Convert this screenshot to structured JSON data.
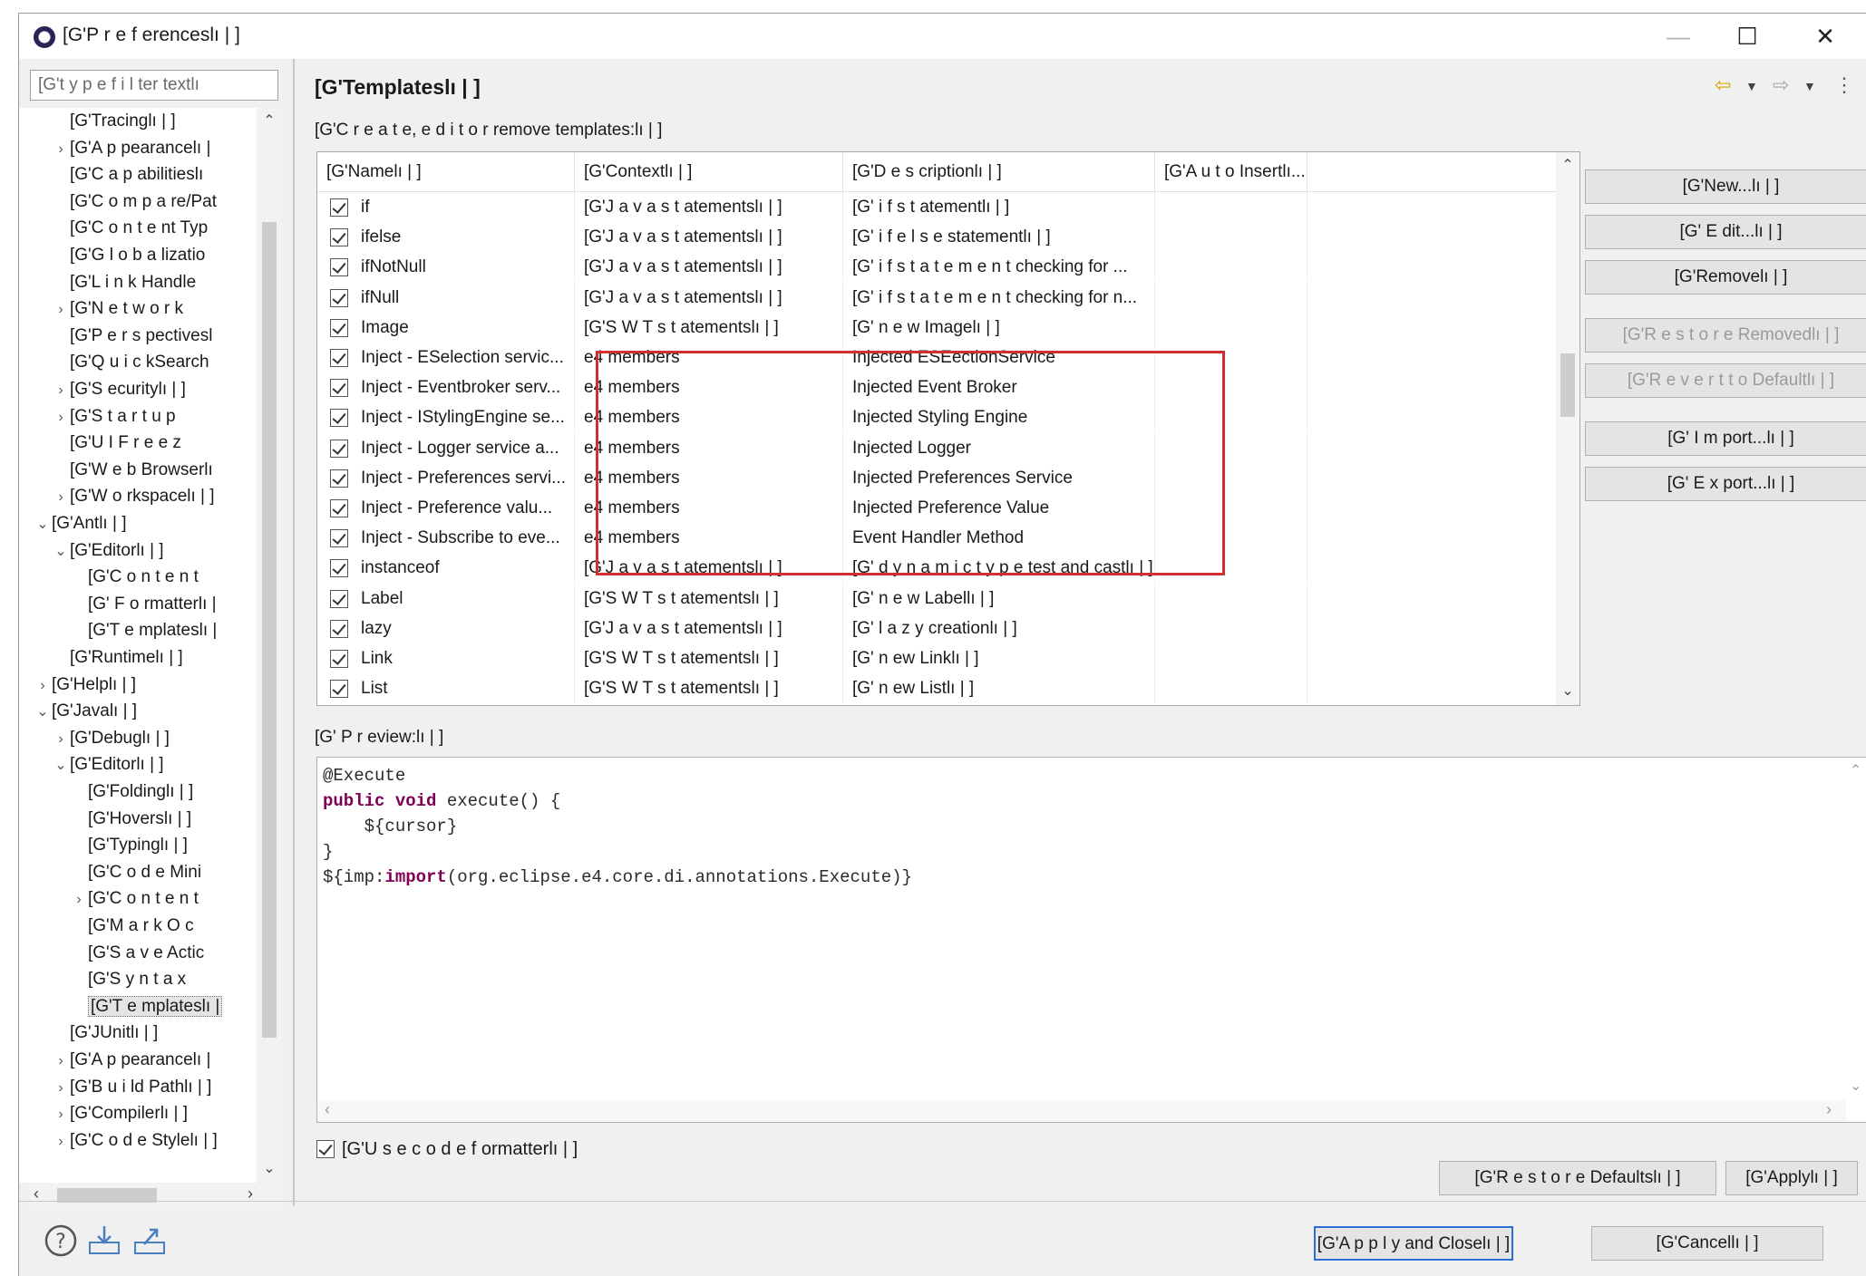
{
  "window": {
    "title": "[G'P r e f erenceslı | ]"
  },
  "filter": {
    "placeholder": "[G't y p e  f i l ter textlı"
  },
  "tree": {
    "items": [
      {
        "label": "[G'Tracinglı | ]",
        "indent": 2,
        "arrow": ""
      },
      {
        "label": "[G'A p pearancelı |",
        "indent": 2,
        "arrow": "›"
      },
      {
        "label": "[G'C a p abilitieslı",
        "indent": 2,
        "arrow": ""
      },
      {
        "label": "[G'C o m p a re/Pat",
        "indent": 2,
        "arrow": ""
      },
      {
        "label": "[G'C o n t e nt Typ",
        "indent": 2,
        "arrow": ""
      },
      {
        "label": "[G'G l o b a lizatio",
        "indent": 2,
        "arrow": ""
      },
      {
        "label": "[G'L i n k  Handle",
        "indent": 2,
        "arrow": ""
      },
      {
        "label": "[G'N e t w o r k",
        "indent": 2,
        "arrow": "›"
      },
      {
        "label": "[G'P e r s pectivesl",
        "indent": 2,
        "arrow": ""
      },
      {
        "label": "[G'Q u i c kSearch",
        "indent": 2,
        "arrow": ""
      },
      {
        "label": "[G'S ecuritylı | ]",
        "indent": 2,
        "arrow": "›"
      },
      {
        "label": "[G'S t a r t u p",
        "indent": 2,
        "arrow": "›"
      },
      {
        "label": "[G'U I  F r e e z",
        "indent": 2,
        "arrow": ""
      },
      {
        "label": "[G'W e b  Browserlı",
        "indent": 2,
        "arrow": ""
      },
      {
        "label": "[G'W o rkspacelı | ]",
        "indent": 2,
        "arrow": "›"
      },
      {
        "label": "[G'Antlı | ]",
        "indent": 1,
        "arrow": "⌄"
      },
      {
        "label": "[G'Editorlı | ]",
        "indent": 2,
        "arrow": "⌄"
      },
      {
        "label": "[G'C o n t e n t",
        "indent": 3,
        "arrow": ""
      },
      {
        "label": "[G' F o rmatterlı |",
        "indent": 3,
        "arrow": ""
      },
      {
        "label": "[G'T e mplateslı |",
        "indent": 3,
        "arrow": ""
      },
      {
        "label": "[G'Runtimelı | ]",
        "indent": 2,
        "arrow": ""
      },
      {
        "label": "[G'Helplı | ]",
        "indent": 1,
        "arrow": "›"
      },
      {
        "label": "[G'Javalı | ]",
        "indent": 1,
        "arrow": "⌄"
      },
      {
        "label": "[G'Debuglı | ]",
        "indent": 2,
        "arrow": "›"
      },
      {
        "label": "[G'Editorlı | ]",
        "indent": 2,
        "arrow": "⌄"
      },
      {
        "label": "[G'Foldinglı | ]",
        "indent": 3,
        "arrow": ""
      },
      {
        "label": "[G'Hoverslı | ]",
        "indent": 3,
        "arrow": ""
      },
      {
        "label": "[G'Typinglı | ]",
        "indent": 3,
        "arrow": ""
      },
      {
        "label": "[G'C o d e  Mini",
        "indent": 3,
        "arrow": ""
      },
      {
        "label": "[G'C o n t e n t",
        "indent": 3,
        "arrow": "›"
      },
      {
        "label": "[G'M a r k  O c",
        "indent": 3,
        "arrow": ""
      },
      {
        "label": "[G'S a v e  Actic",
        "indent": 3,
        "arrow": ""
      },
      {
        "label": "[G'S y n t a x",
        "indent": 3,
        "arrow": ""
      },
      {
        "label": "[G'T e mplateslı |",
        "indent": 3,
        "arrow": "",
        "selected": true
      },
      {
        "label": "[G'JUnitlı | ]",
        "indent": 2,
        "arrow": ""
      },
      {
        "label": "[G'A p pearancelı |",
        "indent": 2,
        "arrow": "›"
      },
      {
        "label": "[G'B u i ld Pathlı | ]",
        "indent": 2,
        "arrow": "›"
      },
      {
        "label": "[G'Compilerlı | ]",
        "indent": 2,
        "arrow": "›"
      },
      {
        "label": "[G'C o d e Stylelı | ]",
        "indent": 2,
        "arrow": "›"
      }
    ]
  },
  "page": {
    "title": "[G'Templateslı | ]",
    "description": "[G'C r e a t e, e d i t o r  remove templates:lı | ]"
  },
  "table": {
    "columns": [
      "[G'Namelı | ]",
      "[G'Contextlı | ]",
      "[G'D e s criptionlı | ]",
      "[G'A u t o Insertlı..."
    ],
    "rows": [
      {
        "name": "if",
        "context": "[G'J a v a  s t atementslı | ]",
        "description": "[G' i f  s t atementlı | ]"
      },
      {
        "name": "ifelse",
        "context": "[G'J a v a  s t atementslı | ]",
        "description": "[G' i f e l s e  statementlı | ]"
      },
      {
        "name": "ifNotNull",
        "context": "[G'J a v a  s t atementslı | ]",
        "description": "[G' i f  s t a t e m e n t  checking for ..."
      },
      {
        "name": "ifNull",
        "context": "[G'J a v a  s t atementslı | ]",
        "description": "[G' i f  s t a t e m e n t  checking for n..."
      },
      {
        "name": "Image",
        "context": "[G'S W T  s t atementslı | ]",
        "description": "[G' n e w Imagelı | ]"
      },
      {
        "name": "Inject - ESelection servic...",
        "context": "e4 members",
        "description": "Injected ESEectionService"
      },
      {
        "name": "Inject - Eventbroker serv...",
        "context": "e4 members",
        "description": "Injected Event Broker"
      },
      {
        "name": "Inject - IStylingEngine se...",
        "context": "e4 members",
        "description": "Injected Styling Engine"
      },
      {
        "name": "Inject - Logger service a...",
        "context": "e4 members",
        "description": "Injected Logger"
      },
      {
        "name": "Inject - Preferences servi...",
        "context": "e4 members",
        "description": "Injected Preferences Service"
      },
      {
        "name": "Inject -  Preference valu...",
        "context": "e4 members",
        "description": "Injected Preference Value"
      },
      {
        "name": "Inject -  Subscribe to eve...",
        "context": "e4 members",
        "description": "Event Handler Method"
      },
      {
        "name": "instanceof",
        "context": "[G'J a v a  s t atementslı | ]",
        "description": "[G' d y n a m i c  t y p e test and castlı | ]"
      },
      {
        "name": "Label",
        "context": "[G'S W T  s t atementslı | ]",
        "description": "[G' n e w Labellı | ]"
      },
      {
        "name": "lazy",
        "context": "[G'J a v a  s t atementslı | ]",
        "description": "[G' l a z y  creationlı | ]"
      },
      {
        "name": "Link",
        "context": "[G'S W T  s t atementslı | ]",
        "description": "[G' n ew Linklı | ]"
      },
      {
        "name": "List",
        "context": "[G'S W T  s t atementslı | ]",
        "description": "[G' n ew Listlı | ]"
      }
    ]
  },
  "side_buttons": {
    "new": "[G'New...lı | ]",
    "edit": "[G' E dit...lı | ]",
    "remove": "[G'Removelı | ]",
    "restore_removed": "[G'R e s t o r e  Removedlı | ]",
    "revert": "[G'R e v e r t  t o Defaultlı | ]",
    "import": "[G' I m port...lı | ]",
    "export": "[G' E x port...lı | ]"
  },
  "preview": {
    "label": "[G' P  r eview:lı | ]",
    "lines": [
      "@Execute",
      "public void execute() {",
      "    ${cursor}",
      "}",
      "${imp:import(org.eclipse.e4.core.di.annotations.Execute)}"
    ]
  },
  "formatter": {
    "label": "[G'U s e  c o d e  f ormatterlı | ]"
  },
  "buttons": {
    "restore_defaults": "[G'R e s t o r e  Defaultslı | ]",
    "apply": "[G'Applylı | ]",
    "apply_close": "[G'A p p l y  and Closelı | ]",
    "cancel": "[G'Cancellı | ]"
  },
  "icons": {
    "help": "help-icon",
    "import_prefs": "import-icon",
    "export_prefs": "export-icon",
    "back": "back-arrow-icon",
    "forward": "forward-arrow-icon",
    "menu": "view-menu-icon"
  },
  "colors": {
    "highlight": "#d32f2f",
    "primary_border": "#2b6fd6",
    "keyword": "#7f0055"
  }
}
